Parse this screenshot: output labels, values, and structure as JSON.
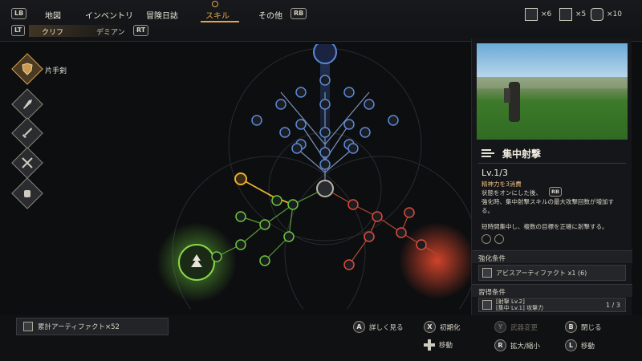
{
  "header": {
    "lb": "LB",
    "rb": "RB",
    "lt": "LT",
    "rt": "RT",
    "tabs": [
      {
        "label": "地図"
      },
      {
        "label": "インベントリ"
      },
      {
        "label": "冒険日誌"
      },
      {
        "label": "スキル"
      },
      {
        "label": "その他"
      }
    ],
    "active_tab": "スキル",
    "subtabs": [
      {
        "label": "クリフ"
      },
      {
        "label": "デミアン"
      }
    ],
    "resources": [
      {
        "icon": "abyss-cube-icon",
        "count": "×6"
      },
      {
        "icon": "artifact-cube-icon",
        "count": "×5"
      },
      {
        "icon": "gear-cube-icon",
        "count": "×10"
      }
    ]
  },
  "weapons": {
    "selected_label": "片手剣",
    "items": [
      {
        "icon": "shield-icon"
      },
      {
        "icon": "spear-icon"
      },
      {
        "icon": "sword-icon"
      },
      {
        "icon": "crossed-blades-icon"
      },
      {
        "icon": "fist-icon"
      }
    ]
  },
  "skill_detail": {
    "name": "集中射撃",
    "level": "Lv.1/3",
    "cost": "精神力を3消費",
    "desc_lines": [
      "状態をオンにした後、",
      "強化時、集中射撃スキルの最大攻撃回数が増加す",
      "る。"
    ],
    "rb_tag": "RB",
    "effect": "短時間集中し、複数の目標を正確に射撃する。",
    "enhance_header": "強化条件",
    "enhance_item": "アビスアーティファクト x1 (6)",
    "learn_header": "習得条件",
    "learn_item_1": "[射撃 Lv.2]",
    "learn_item_2": "[集中 Lv.1] 攻撃力",
    "page": "1 / 3"
  },
  "footer": {
    "artifact_total": "累計アーティファクト×52",
    "commands": [
      {
        "key": "A",
        "label": "詳しく見る"
      },
      {
        "key": "X",
        "label": "初期化"
      },
      {
        "key": "Y",
        "label": "武器変更"
      },
      {
        "key": "B",
        "label": "閉じる"
      },
      {
        "key": "✚",
        "label": "移動"
      },
      {
        "key": "R",
        "label": "拡大/縮小"
      },
      {
        "key": "L",
        "label": "移動"
      }
    ]
  },
  "colors": {
    "accent": "#e0a64a",
    "branch_blue": "#5a8ad8",
    "branch_green": "#6ac83a",
    "branch_red": "#e04a3a",
    "highlight_yellow": "#e8b030"
  }
}
